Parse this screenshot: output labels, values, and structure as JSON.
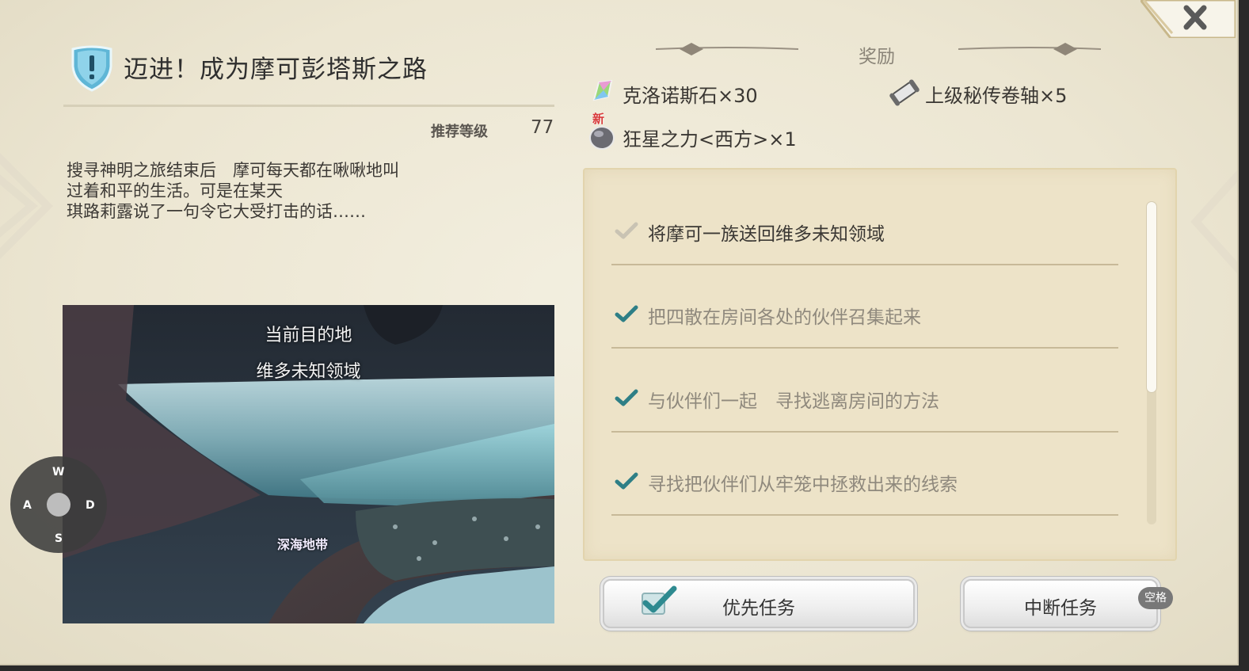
{
  "quest": {
    "title": "迈进！成为摩可彭塔斯之路",
    "level_label": "推荐等级",
    "level_value": "77",
    "description": [
      "搜寻神明之旅结束后　摩可每天都在啾啾地叫",
      "过着和平的生活。可是在某天",
      "琪路莉露说了一句令它大受打击的话……"
    ]
  },
  "map": {
    "destination_label": "当前目的地",
    "destination_name": "维多未知领域",
    "zone_label": "深海地带"
  },
  "dpad": {
    "up": "W",
    "left": "A",
    "right": "D",
    "down": "S"
  },
  "rewards": {
    "header": "奖励",
    "items": [
      {
        "name": "克洛诺斯石×30",
        "icon": "chronos-stone-icon"
      },
      {
        "name": "上级秘传卷轴×5",
        "icon": "scroll-icon"
      },
      {
        "name": "狂星之力<西方>×1",
        "icon": "star-stone-icon",
        "badge": "新"
      }
    ]
  },
  "objectives": [
    {
      "text": "将摩可一族送回维多未知领域",
      "state": "current"
    },
    {
      "text": "把四散在房间各处的伙伴召集起来",
      "state": "done"
    },
    {
      "text": "与伙伴们一起　寻找逃离房间的方法",
      "state": "done"
    },
    {
      "text": "寻找把伙伴们从牢笼中拯救出来的线索",
      "state": "done"
    }
  ],
  "buttons": {
    "priority": "优先任务",
    "abort": "中断任务",
    "abort_key": "空格"
  },
  "colors": {
    "check_done": "#2e7f86",
    "check_current": "#c9c3b3",
    "text_current": "#3b3834",
    "text_done": "#8f897d"
  }
}
